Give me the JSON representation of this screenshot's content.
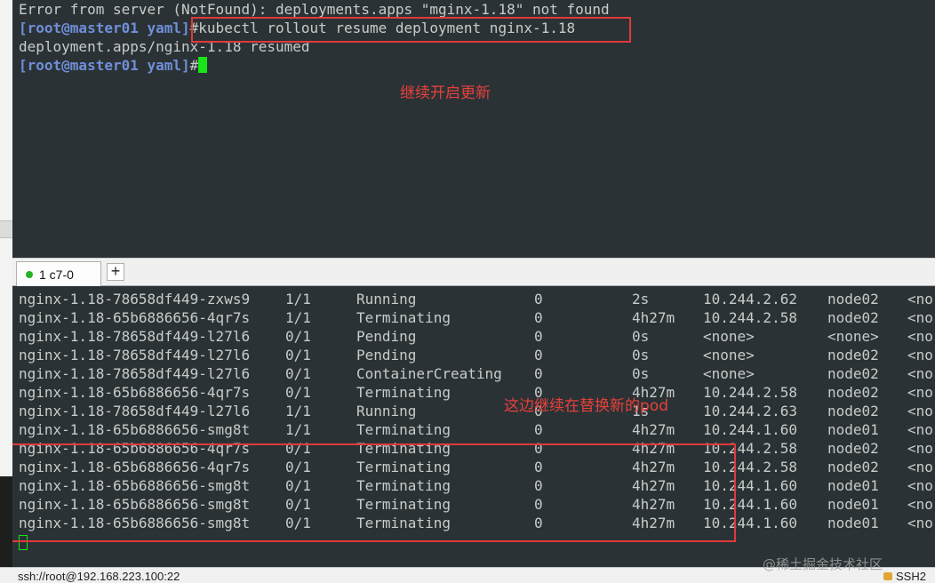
{
  "top_terminal": {
    "line1": "Error from server (NotFound): deployments.apps \"mginx-1.18\" not found",
    "line2_prompt": "[root@master01 yaml]",
    "line2_cmd": "#kubectl rollout resume deployment nginx-1.18",
    "line3": "deployment.apps/nginx-1.18 resumed",
    "line4_prompt": "[root@master01 yaml]",
    "line4_cmd": "#",
    "annotation": "继续开启更新"
  },
  "tab_bar": {
    "tab_label": "1 c7-0",
    "add_tab": "+"
  },
  "bottom_terminal": {
    "rows": [
      {
        "name": "nginx-1.18-78658df449-zxws9",
        "ready": "1/1",
        "status": "Running",
        "restarts": "0",
        "age": "2s",
        "ip": "10.244.2.62",
        "node": "node02",
        "nominated": "<no"
      },
      {
        "name": "nginx-1.18-65b6886656-4qr7s",
        "ready": "1/1",
        "status": "Terminating",
        "restarts": "0",
        "age": "4h27m",
        "ip": "10.244.2.58",
        "node": "node02",
        "nominated": "<no"
      },
      {
        "name": "nginx-1.18-78658df449-l27l6",
        "ready": "0/1",
        "status": "Pending",
        "restarts": "0",
        "age": "0s",
        "ip": "<none>",
        "node": "<none>",
        "nominated": "<no"
      },
      {
        "name": "nginx-1.18-78658df449-l27l6",
        "ready": "0/1",
        "status": "Pending",
        "restarts": "0",
        "age": "0s",
        "ip": "<none>",
        "node": "node02",
        "nominated": "<no"
      },
      {
        "name": "nginx-1.18-78658df449-l27l6",
        "ready": "0/1",
        "status": "ContainerCreating",
        "restarts": "0",
        "age": "0s",
        "ip": "<none>",
        "node": "node02",
        "nominated": "<no"
      },
      {
        "name": "nginx-1.18-65b6886656-4qr7s",
        "ready": "0/1",
        "status": "Terminating",
        "restarts": "0",
        "age": "4h27m",
        "ip": "10.244.2.58",
        "node": "node02",
        "nominated": "<no"
      },
      {
        "name": "nginx-1.18-78658df449-l27l6",
        "ready": "1/1",
        "status": "Running",
        "restarts": "0",
        "age": "1s",
        "ip": "10.244.2.63",
        "node": "node02",
        "nominated": "<no"
      },
      {
        "name": "nginx-1.18-65b6886656-smg8t",
        "ready": "1/1",
        "status": "Terminating",
        "restarts": "0",
        "age": "4h27m",
        "ip": "10.244.1.60",
        "node": "node01",
        "nominated": "<no"
      },
      {
        "name": "nginx-1.18-65b6886656-4qr7s",
        "ready": "0/1",
        "status": "Terminating",
        "restarts": "0",
        "age": "4h27m",
        "ip": "10.244.2.58",
        "node": "node02",
        "nominated": "<no"
      },
      {
        "name": "nginx-1.18-65b6886656-4qr7s",
        "ready": "0/1",
        "status": "Terminating",
        "restarts": "0",
        "age": "4h27m",
        "ip": "10.244.2.58",
        "node": "node02",
        "nominated": "<no"
      },
      {
        "name": "nginx-1.18-65b6886656-smg8t",
        "ready": "0/1",
        "status": "Terminating",
        "restarts": "0",
        "age": "4h27m",
        "ip": "10.244.1.60",
        "node": "node01",
        "nominated": "<no"
      },
      {
        "name": "nginx-1.18-65b6886656-smg8t",
        "ready": "0/1",
        "status": "Terminating",
        "restarts": "0",
        "age": "4h27m",
        "ip": "10.244.1.60",
        "node": "node01",
        "nominated": "<no"
      },
      {
        "name": "nginx-1.18-65b6886656-smg8t",
        "ready": "0/1",
        "status": "Terminating",
        "restarts": "0",
        "age": "4h27m",
        "ip": "10.244.1.60",
        "node": "node01",
        "nominated": "<no"
      }
    ],
    "annotation": "这边继续在替换新的pod"
  },
  "status_bar": {
    "connection": "ssh://root@192.168.223.100:22",
    "protocol": "SSH2"
  },
  "watermark": "@稀土掘金技术社区",
  "colors": {
    "terminal_bg": "#2b3236",
    "prompt": "#6f8fd8",
    "cursor": "#19e619",
    "annotation": "#e8403a"
  }
}
